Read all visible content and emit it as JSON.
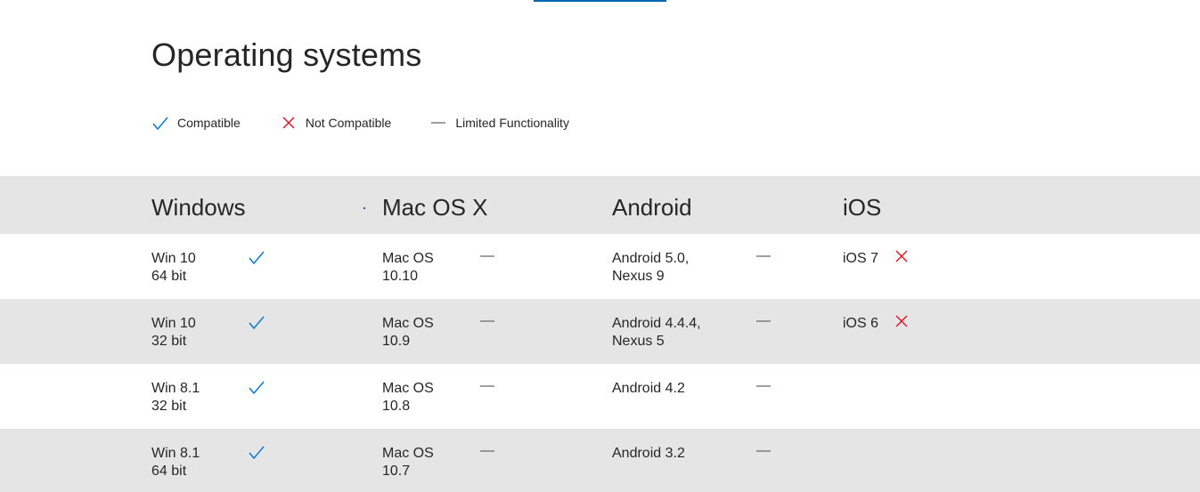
{
  "page": {
    "title": "Operating systems"
  },
  "legend": [
    {
      "icon": "check-icon",
      "label": "Compatible"
    },
    {
      "icon": "x-icon",
      "label": "Not Compatible"
    },
    {
      "icon": "dash-icon",
      "label": "Limited Functionality"
    }
  ],
  "colors": {
    "accent": "#0067b8",
    "check": "#0078d4",
    "cross": "#e81123",
    "dash": "#777777",
    "band": "#e5e5e5"
  },
  "table": {
    "headers": [
      "Windows",
      "Mac OS X",
      "Android",
      "iOS"
    ],
    "rows": [
      {
        "windows": {
          "label": "Win 10\n64 bit",
          "status": "check-icon"
        },
        "mac": {
          "label": "Mac OS\n10.10",
          "status": "dash-icon"
        },
        "android": {
          "label": "Android 5.0,\nNexus 9",
          "status": "dash-icon"
        },
        "ios": {
          "label": "iOS 7",
          "status": "x-icon"
        }
      },
      {
        "windows": {
          "label": "Win 10\n32 bit",
          "status": "check-icon"
        },
        "mac": {
          "label": "Mac OS\n10.9",
          "status": "dash-icon"
        },
        "android": {
          "label": "Android 4.4.4,\nNexus 5",
          "status": "dash-icon"
        },
        "ios": {
          "label": "iOS 6",
          "status": "x-icon"
        }
      },
      {
        "windows": {
          "label": "Win 8.1\n32 bit",
          "status": "check-icon"
        },
        "mac": {
          "label": "Mac OS\n10.8",
          "status": "dash-icon"
        },
        "android": {
          "label": "Android 4.2",
          "status": "dash-icon"
        }
      },
      {
        "windows": {
          "label": "Win 8.1\n64 bit",
          "status": "check-icon"
        },
        "mac": {
          "label": "Mac OS\n10.7",
          "status": "dash-icon"
        },
        "android": {
          "label": "Android 3.2",
          "status": "dash-icon"
        }
      }
    ]
  }
}
